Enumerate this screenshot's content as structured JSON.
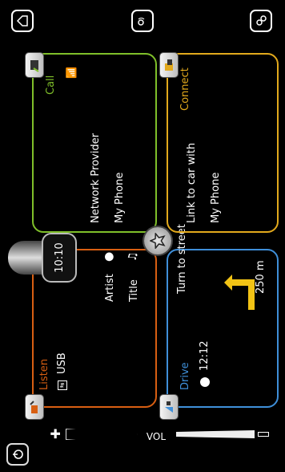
{
  "top_icons": [
    "home-icon",
    "voice-icon",
    "settings-icon"
  ],
  "clock": {
    "time": "10:10"
  },
  "listen": {
    "header": "Listen",
    "source": "USB",
    "artist_label": "Artist",
    "title_label": "Title",
    "color": "#d85f12"
  },
  "drive": {
    "header": "Drive",
    "instruction": "Turn to street",
    "time": "12:12",
    "distance": "250 m",
    "color": "#3f8fd9"
  },
  "call": {
    "header": "Call",
    "line1": "Network Provider",
    "line2": "My Phone",
    "color": "#7fbf2a"
  },
  "connect": {
    "header": "Connect",
    "line1": "Link to car with",
    "line2": "My Phone",
    "color": "#e2a91c"
  },
  "volume": {
    "label": "VOL"
  }
}
